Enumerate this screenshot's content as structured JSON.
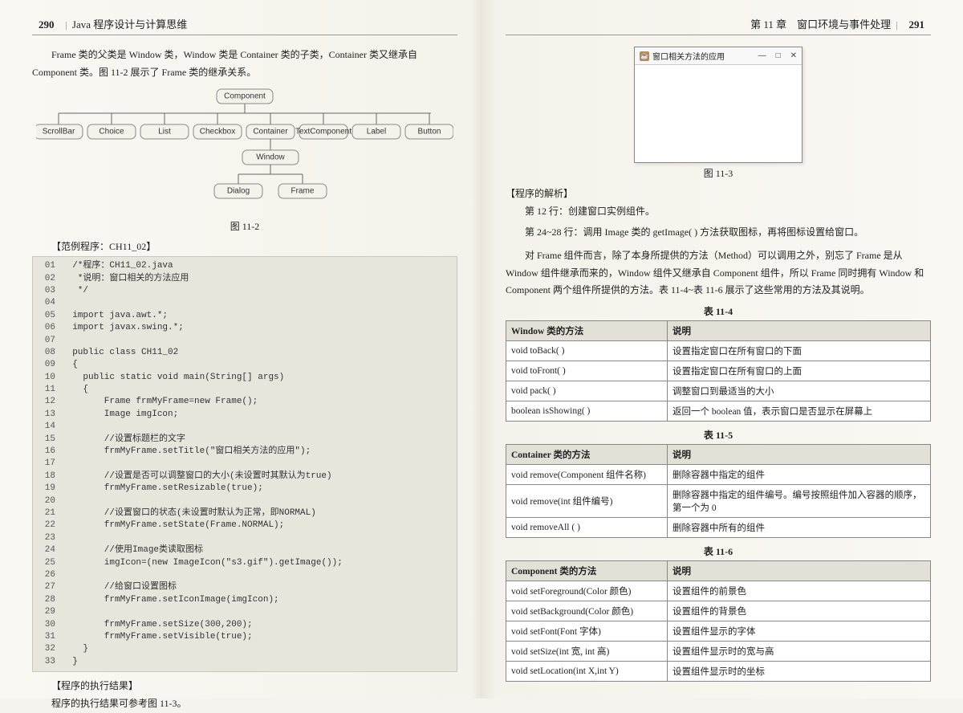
{
  "left": {
    "pageNum": "290",
    "bookTitle": "Java 程序设计与计算思维",
    "para1": "Frame 类的父类是 Window 类，Window 类是 Container 类的子类，Container 类又继承自 Component 类。图 11-2 展示了 Frame 类的继承关系。",
    "diagram": {
      "top": "Component",
      "row2": [
        "ScrollBar",
        "Choice",
        "List",
        "Checkbox",
        "Container",
        "TextComponent",
        "Label",
        "Button"
      ],
      "win": "Window",
      "leaves": [
        "Dialog",
        "Frame"
      ]
    },
    "fig1": "图 11-2",
    "example": "【范例程序：CH11_02】",
    "code": [
      {
        "n": "01",
        "t": "  /*程序：CH11_02.java"
      },
      {
        "n": "02",
        "t": "   *说明：窗口相关的方法应用"
      },
      {
        "n": "03",
        "t": "   */"
      },
      {
        "n": "04",
        "t": ""
      },
      {
        "n": "05",
        "t": "  import java.awt.*;"
      },
      {
        "n": "06",
        "t": "  import javax.swing.*;"
      },
      {
        "n": "07",
        "t": ""
      },
      {
        "n": "08",
        "t": "  public class CH11_02"
      },
      {
        "n": "09",
        "t": "  {"
      },
      {
        "n": "10",
        "t": "    public static void main(String[] args)"
      },
      {
        "n": "11",
        "t": "    {"
      },
      {
        "n": "12",
        "t": "        Frame frmMyFrame=new Frame();"
      },
      {
        "n": "13",
        "t": "        Image imgIcon;"
      },
      {
        "n": "14",
        "t": ""
      },
      {
        "n": "15",
        "t": "        //设置标题栏的文字"
      },
      {
        "n": "16",
        "t": "        frmMyFrame.setTitle(\"窗口相关方法的应用\");"
      },
      {
        "n": "17",
        "t": ""
      },
      {
        "n": "18",
        "t": "        //设置是否可以调整窗口的大小(未设置时其默认为true)"
      },
      {
        "n": "19",
        "t": "        frmMyFrame.setResizable(true);"
      },
      {
        "n": "20",
        "t": ""
      },
      {
        "n": "21",
        "t": "        //设置窗口的状态(未设置时默认为正常，即NORMAL)"
      },
      {
        "n": "22",
        "t": "        frmMyFrame.setState(Frame.NORMAL);"
      },
      {
        "n": "23",
        "t": ""
      },
      {
        "n": "24",
        "t": "        //使用Image类读取图标"
      },
      {
        "n": "25",
        "t": "        imgIcon=(new ImageIcon(\"s3.gif\").getImage());"
      },
      {
        "n": "26",
        "t": ""
      },
      {
        "n": "27",
        "t": "        //给窗口设置图标"
      },
      {
        "n": "28",
        "t": "        frmMyFrame.setIconImage(imgIcon);"
      },
      {
        "n": "29",
        "t": ""
      },
      {
        "n": "30",
        "t": "        frmMyFrame.setSize(300,200);"
      },
      {
        "n": "31",
        "t": "        frmMyFrame.setVisible(true);"
      },
      {
        "n": "32",
        "t": "    }"
      },
      {
        "n": "33",
        "t": "  }"
      }
    ],
    "result": "【程序的执行结果】",
    "resultText": "程序的执行结果可参考图 11-3。"
  },
  "right": {
    "chapTitle": "第 11 章　窗口环境与事件处理",
    "pageNum": "291",
    "winTitle": "窗口相关方法的应用",
    "winMin": "—",
    "winMax": "□",
    "winClose": "✕",
    "fig2": "图 11-3",
    "analysis": "【程序的解析】",
    "a1": "第 12 行：创建窗口实例组件。",
    "a2": "第 24~28 行：调用 Image 类的 getImage( ) 方法获取图标，再将图标设置给窗口。",
    "para2": "对 Frame 组件而言，除了本身所提供的方法（Method）可以调用之外，别忘了 Frame 是从 Window 组件继承而来的，Window 组件又继承自 Component 组件，所以 Frame 同时拥有 Window 和 Component 两个组件所提供的方法。表 11-4~表 11-6 展示了这些常用的方法及其说明。",
    "t4cap": "表 11-4",
    "t4h1": "Window 类的方法",
    "t4h2": "说明",
    "t4": [
      {
        "m": "void toBack( )",
        "d": "设置指定窗口在所有窗口的下面"
      },
      {
        "m": "void toFront( )",
        "d": "设置指定窗口在所有窗口的上面"
      },
      {
        "m": "void pack( )",
        "d": "调整窗口到最适当的大小"
      },
      {
        "m": "boolean isShowing( )",
        "d": "返回一个 boolean 值，表示窗口是否显示在屏幕上"
      }
    ],
    "t5cap": "表 11-5",
    "t5h1": "Container 类的方法",
    "t5h2": "说明",
    "t5": [
      {
        "m": "void remove(Component  组件名称)",
        "d": "删除容器中指定的组件"
      },
      {
        "m": "void remove(int  组件编号)",
        "d": "删除容器中指定的组件编号。编号按照组件加入容器的顺序，第一个为 0"
      },
      {
        "m": "void removeAll ( )",
        "d": "删除容器中所有的组件"
      }
    ],
    "t6cap": "表 11-6",
    "t6h1": "Component 类的方法",
    "t6h2": "说明",
    "t6": [
      {
        "m": "void setForeground(Color  颜色)",
        "d": "设置组件的前景色"
      },
      {
        "m": "void setBackground(Color  颜色)",
        "d": "设置组件的背景色"
      },
      {
        "m": "void setFont(Font  字体)",
        "d": "设置组件显示的字体"
      },
      {
        "m": "void setSize(int  宽, int  高)",
        "d": "设置组件显示时的宽与高"
      },
      {
        "m": "void setLocation(int X,int Y)",
        "d": "设置组件显示时的坐标"
      }
    ]
  }
}
